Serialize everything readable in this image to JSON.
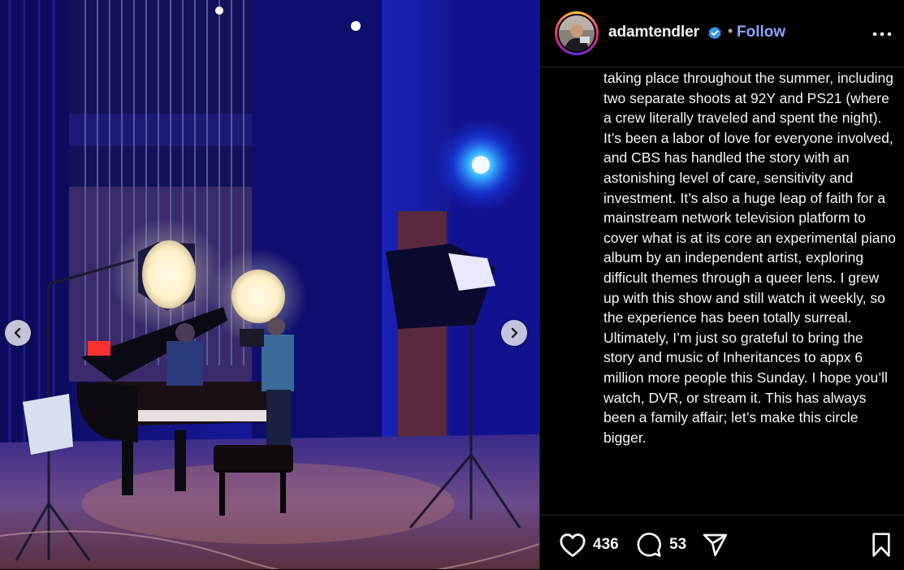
{
  "post": {
    "username": "adamtendler",
    "separator": "•",
    "follow_label": "Follow",
    "caption": "taking place throughout the summer, including two separate shoots at 92Y and PS21 (where a crew literally traveled and spent the night). It’s been a labor of love for everyone involved, and CBS has handled the story with an astonishing level of care, sensitivity and investment. It’s also a huge leap of faith for a mainstream network television platform to cover what is at its core an experimental piano album by an independent artist, exploring difficult themes through a queer lens. I grew up with this show and still watch it weekly, so the experience has been totally surreal. Ultimately, I’m just so grateful to bring the story and music of Inheritances to appx 6 million more people this Sunday. I hope you’ll watch, DVR, or stream it. This has always been a family affair; let’s make this circle bigger.",
    "likes": "436",
    "comments": "53"
  },
  "icons": {
    "verified": "verified-badge-icon",
    "more": "more-options-icon",
    "like": "heart-icon",
    "comment": "comment-icon",
    "share": "share-icon",
    "save": "bookmark-icon",
    "prev": "chevron-left-icon",
    "next": "chevron-right-icon"
  },
  "colors": {
    "background": "#000000",
    "follow_accent": "#8ea2ff",
    "verified": "#3897f0",
    "stage_blue": "#1a1aa8"
  }
}
